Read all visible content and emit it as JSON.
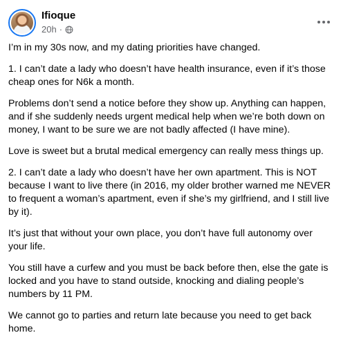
{
  "post": {
    "author": "Ifioque",
    "time": "20h",
    "separator": "·",
    "paragraphs": [
      "I’m in my 30s now, and my dating priorities have changed.",
      "1. I can’t date a lady who doesn’t have health insurance, even if it’s those cheap ones for N6k a month.",
      "Problems don’t send a notice before they show up. Anything can happen, and if she suddenly needs urgent medical help when we’re both down on money, I want to be sure we are not badly affected (I have mine).",
      "Love is sweet but a brutal medical emergency can really mess things up.",
      "2. I can’t date a lady who doesn’t have her own apartment. This is NOT because I want to live there (in 2016, my older brother warned me NEVER to frequent a woman’s apartment, even if she’s my girlfriend, and I still live by it).",
      "It’s just that without your own place, you don’t have full autonomy over your life.",
      "You still have a curfew and you must be back before then, else the gate is locked and you have to stand outside, knocking and dialing people’s numbers by 11 PM.",
      "We cannot go to parties and return late because you need to get back home."
    ]
  },
  "icons": {
    "privacy": "globe-icon",
    "menu": "more-options-icon"
  },
  "colors": {
    "avatar_ring": "#1877f2",
    "meta_text": "#65676b",
    "body_text": "#050505"
  }
}
